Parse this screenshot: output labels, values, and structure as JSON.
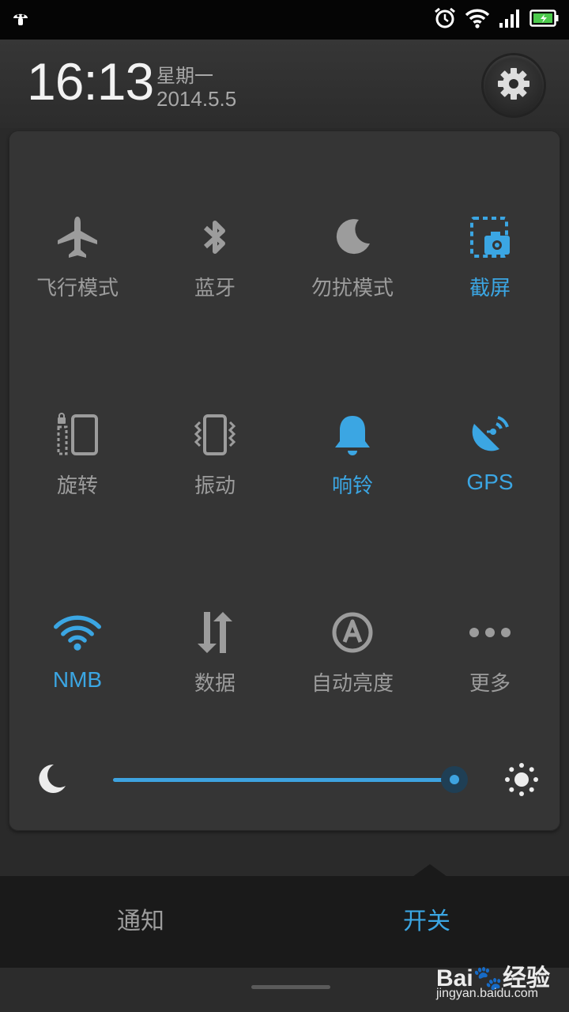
{
  "status_bar": {
    "left_icon": "mushroom-notification-icon",
    "right_icons": [
      "alarm-clock-icon",
      "wifi-icon",
      "cellular-signal-icon",
      "battery-charging-icon"
    ]
  },
  "header": {
    "time": "16:13",
    "weekday": "星期一",
    "date": "2014.5.5",
    "settings_icon": "gear-icon"
  },
  "toggles": [
    {
      "label": "飞行模式",
      "icon": "airplane-icon",
      "on": false
    },
    {
      "label": "蓝牙",
      "icon": "bluetooth-icon",
      "on": false
    },
    {
      "label": "勿扰模式",
      "icon": "moon-icon",
      "on": false
    },
    {
      "label": "截屏",
      "icon": "screenshot-camera-icon",
      "on": true
    },
    {
      "label": "旋转",
      "icon": "rotation-lock-icon",
      "on": false
    },
    {
      "label": "振动",
      "icon": "vibrate-phone-icon",
      "on": false
    },
    {
      "label": "响铃",
      "icon": "bell-icon",
      "on": true
    },
    {
      "label": "GPS",
      "icon": "gps-satellite-icon",
      "on": true
    },
    {
      "label": "NMB",
      "icon": "wifi-icon",
      "on": true
    },
    {
      "label": "数据",
      "icon": "data-arrows-icon",
      "on": false
    },
    {
      "label": "自动亮度",
      "icon": "auto-brightness-icon",
      "on": false
    },
    {
      "label": "更多",
      "icon": "more-dots-icon",
      "on": false
    }
  ],
  "brightness": {
    "level": 0.99,
    "low_icon": "moon-icon",
    "high_icon": "sun-icon"
  },
  "tabs": {
    "notify": "通知",
    "switch": "开关",
    "active": "开关"
  },
  "watermark": {
    "brand": "Bai🐾经验",
    "url": "jingyan.baidu.com"
  },
  "colors": {
    "accent": "#3ba6e3",
    "inactive": "#9c9c9c"
  }
}
